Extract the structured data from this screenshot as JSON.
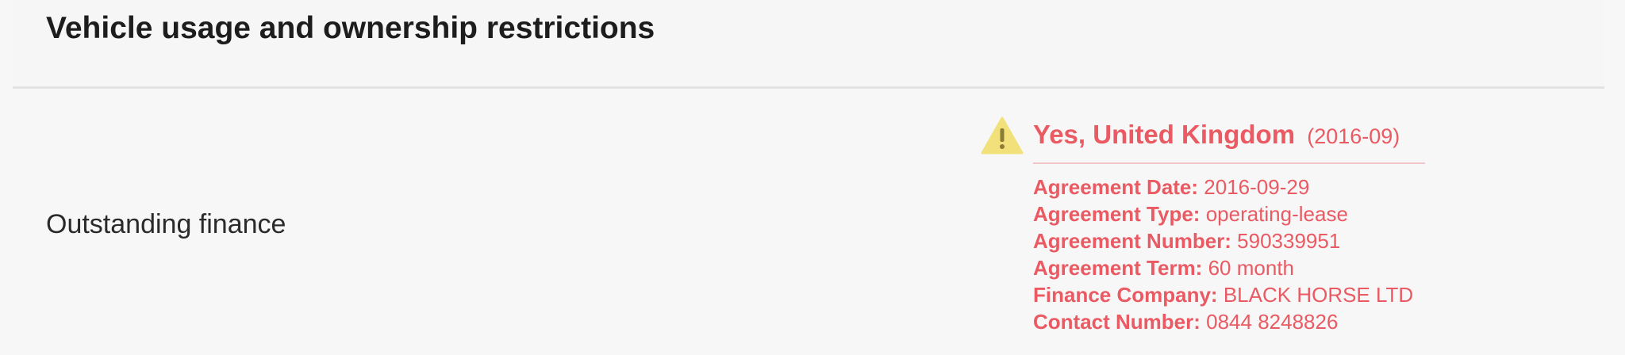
{
  "section": {
    "title": "Vehicle usage and ownership restrictions"
  },
  "row": {
    "label": "Outstanding finance",
    "status": {
      "value": "Yes, United Kingdom",
      "date": "(2016-09)",
      "icon": "warning-icon"
    },
    "details": [
      {
        "key": "Agreement Date:",
        "value": "2016-09-29"
      },
      {
        "key": "Agreement Type:",
        "value": "operating-lease"
      },
      {
        "key": "Agreement Number:",
        "value": "590339951"
      },
      {
        "key": "Agreement Term:",
        "value": "60 month"
      },
      {
        "key": "Finance Company:",
        "value": "BLACK HORSE LTD"
      },
      {
        "key": "Contact Number:",
        "value": "0844 8248826"
      }
    ]
  },
  "colors": {
    "alert": "#ea5a63",
    "warning_icon": "#f2e07a",
    "background": "#f7f7f7"
  }
}
